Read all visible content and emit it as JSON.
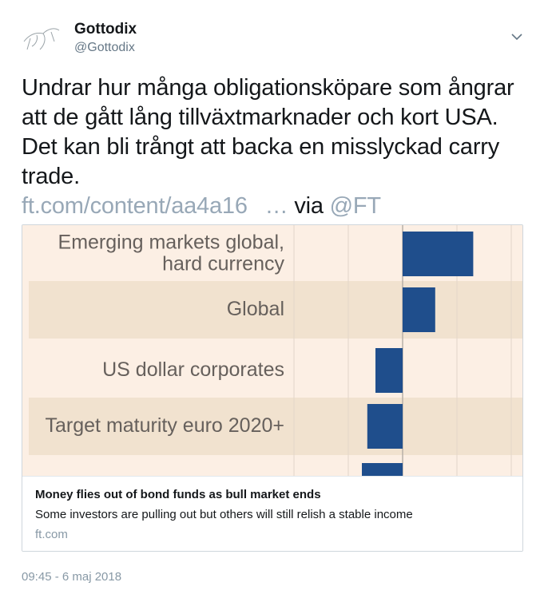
{
  "author": {
    "name": "Gottodix",
    "handle": "@Gottodix"
  },
  "tweet": {
    "text": "Undrar hur många obligationsköpare som ångrar att de gått lång tillväxtmarknader och kort USA. Det kan bli trångt att backa en misslyckad carry trade.",
    "link": "ft.com/content/aa4a16",
    "ellipsis": "…",
    "via": "via",
    "mention": "@FT"
  },
  "card": {
    "title": "Money flies out of bond funds as bull market ends",
    "description": "Some investors are pulling out but others will still relish a stable income",
    "domain": "ft.com"
  },
  "chart_data": {
    "type": "bar",
    "orientation": "horizontal",
    "categories": [
      "Emerging markets global, hard currency",
      "Global",
      "US dollar corporates",
      "Target maturity euro 2020+",
      ""
    ],
    "category_lines": [
      [
        "Emerging markets global,",
        "hard currency"
      ],
      [
        "Global"
      ],
      [
        "US dollar corporates"
      ],
      [
        "Target maturity euro 2020+"
      ],
      [
        ""
      ]
    ],
    "values": [
      1.3,
      0.6,
      -0.5,
      -0.65,
      -0.75
    ],
    "xlim": [
      -2,
      2
    ],
    "grid": true,
    "bar_color": "#1f4e8c",
    "band_color": "#f1e2cf",
    "background_color": "#fcefe4"
  },
  "timestamp": "09:45 - 6 maj 2018",
  "colors": {
    "link": "#98a8b7",
    "text": "#14171a",
    "secondary": "#657786"
  }
}
